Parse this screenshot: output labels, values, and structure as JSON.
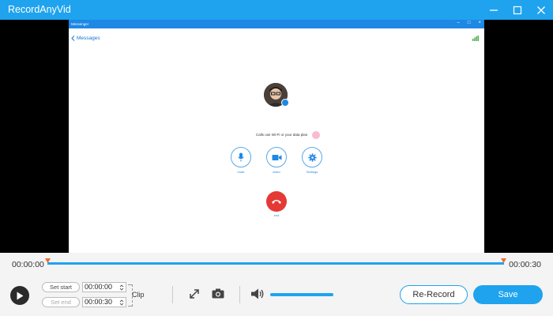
{
  "app": {
    "title": "RecordAnyVid"
  },
  "inner_window": {
    "title": "Messenger",
    "back_label": "Messages",
    "status_text": "Calls use Wi-Fi or your data plan",
    "buttons": [
      {
        "label": "mute"
      },
      {
        "label": "video"
      },
      {
        "label": "Settings"
      }
    ],
    "end_label": "end"
  },
  "timeline": {
    "start": "00:00:00",
    "end": "00:00:30"
  },
  "clip": {
    "set_start_label": "Set start",
    "set_end_label": "Set end",
    "start_value": "00:00:00",
    "end_value": "00:00:30",
    "label": "Clip"
  },
  "actions": {
    "rerecord": "Re-Record",
    "save": "Save"
  },
  "colors": {
    "accent": "#1fa3ee",
    "end_call": "#e53935"
  }
}
